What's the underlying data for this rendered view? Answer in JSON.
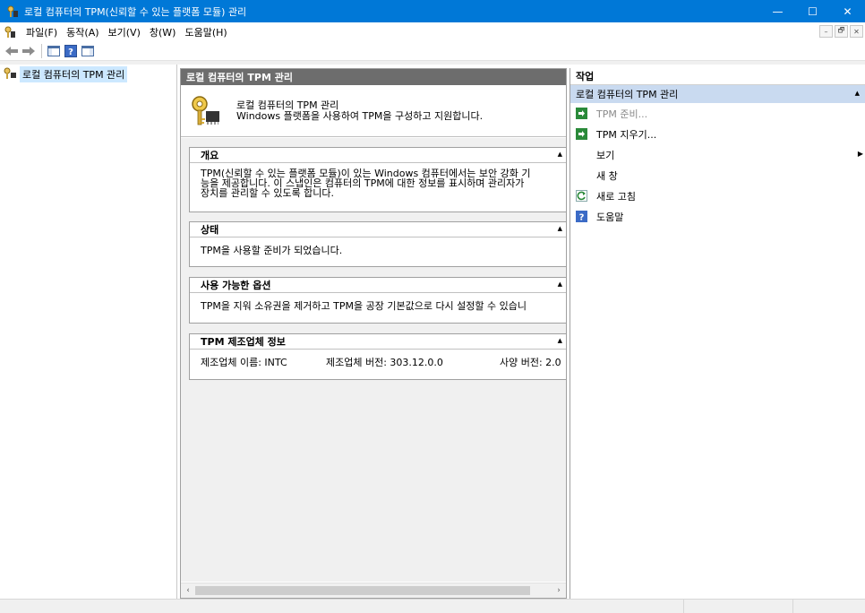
{
  "window": {
    "title": "로컬 컴퓨터의 TPM(신뢰할 수 있는 플랫폼 모듈) 관리",
    "minimize": "—",
    "maximize": "☐",
    "close": "✕"
  },
  "menu": {
    "items": [
      "파일(F)",
      "동작(A)",
      "보기(V)",
      "창(W)",
      "도움말(H)"
    ],
    "mdi": [
      "–",
      "🗗",
      "✕"
    ]
  },
  "tree": {
    "root_label": "로컬 컴퓨터의 TPM 관리"
  },
  "center": {
    "header": "로컬 컴퓨터의 TPM 관리",
    "intro_title": "로컬 컴퓨터의 TPM 관리",
    "intro_desc": "Windows 플랫폼을 사용하여 TPM을 구성하고 지원합니다.",
    "sections": [
      {
        "title": "개요",
        "lines": [
          "TPM(신뢰할 수 있는 플랫폼 모듈)이 있는 Windows 컴퓨터에서는 보안 강화 기",
          "능을 제공합니다. 이 스냅인은 컴퓨터의 TPM에 대한 정보를 표시하며 관리자가",
          "장치를 관리할 수 있도록 합니다."
        ]
      },
      {
        "title": "상태",
        "lines": [
          "TPM을 사용할 준비가 되었습니다."
        ]
      },
      {
        "title": "사용 가능한 옵션",
        "lines": [
          " TPM을 지워 소유권을 제거하고 TPM을 공장 기본값으로 다시 설정할 수 있습니"
        ]
      },
      {
        "title": "TPM 제조업체 정보",
        "manufacturer_name": "제조업체 이름: INTC",
        "manufacturer_version": "제조업체 버전: 303.12.0.0",
        "spec_version": "사양 버전: 2.0"
      }
    ]
  },
  "actions": {
    "title": "작업",
    "group": "로컬 컴퓨터의 TPM 관리",
    "items": [
      {
        "label": "TPM 준비...",
        "icon": "green-arrow-icon",
        "disabled": true
      },
      {
        "label": "TPM 지우기...",
        "icon": "green-arrow-icon",
        "disabled": false
      },
      {
        "label": "보기",
        "icon": "",
        "disabled": false
      },
      {
        "label": "새 창",
        "icon": "",
        "disabled": false
      },
      {
        "label": "새로 고침",
        "icon": "refresh-icon",
        "disabled": false
      },
      {
        "label": "도움말",
        "icon": "help-icon",
        "disabled": false
      }
    ]
  },
  "colors": {
    "titlebar": "#0078d7",
    "pane_header": "#6d6d6d",
    "actions_group": "#c9daf0",
    "tree_selection": "#cce8ff",
    "action_icon_green": "#2a8a3a"
  }
}
